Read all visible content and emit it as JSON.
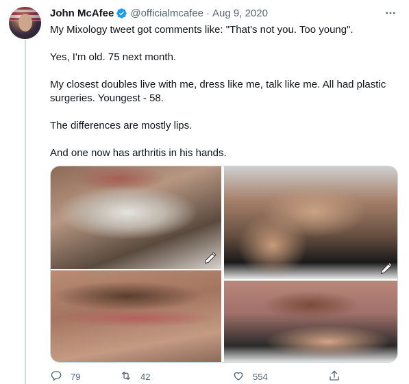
{
  "author": {
    "name": "John McAfee",
    "handle": "@officialmcafee",
    "separator": "·",
    "date": "Aug 9, 2020",
    "verified_color": "#1d9bf0"
  },
  "tweet": {
    "paragraphs": [
      "My Mixology tweet got comments like: \"That's not you. Too young\".",
      "Yes, I'm old. 75 next month.",
      "My closest doubles live with me, dress like me, talk like me. All had plastic surgeries. Youngest - 58.",
      "The differences are mostly lips.",
      "And one now has arthritis in his hands."
    ]
  },
  "media": {
    "photos": [
      "chin-closeup-photo",
      "lips-closeup-photo",
      "hand-on-cheek-photo",
      "chin-on-hand-photo"
    ],
    "edit_icon": "pencil-icon"
  },
  "actions": {
    "reply_count": "79",
    "retweet_count": "42",
    "like_count": "554",
    "icon_color": "#536471"
  },
  "icons": {
    "more": "more-options-icon",
    "reply": "reply-icon",
    "retweet": "retweet-icon",
    "like": "heart-icon",
    "share": "share-icon"
  }
}
